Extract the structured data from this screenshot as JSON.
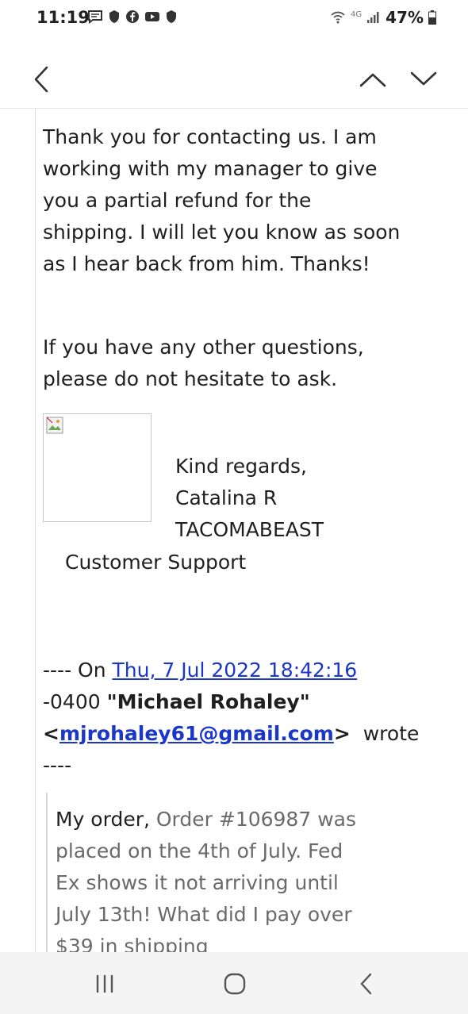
{
  "status_bar": {
    "time": "11:19",
    "network": "4G",
    "battery": "47%"
  },
  "toolbar": {
    "back_icon": "chevron-left-icon",
    "prev_icon": "chevron-up-icon",
    "next_icon": "chevron-down-icon"
  },
  "email": {
    "paragraph1": "Thank you for contacting us. I am working with my manager to give you a partial refund for the shipping. I will let you know as soon as I hear back from him. Thanks!",
    "paragraph2": "If you have any other questions, please do not hesitate to ask.",
    "signature": {
      "line1": "Kind regards,",
      "line2": "Catalina R",
      "line3": "TACOMABEAST",
      "line4": "Customer Support"
    },
    "quote_header": {
      "prefix": "---- On",
      "date_link": "Thu, 7 Jul 2022 18:42:16",
      "tz": "-0400",
      "sender_name": "\"Michael Rohaley\"",
      "lt": "<",
      "sender_email": "mjrohaley61@gmail.com",
      "gt": ">",
      "wrote": "wrote",
      "suffix": "----"
    },
    "quoted": {
      "lead": "My order,",
      "text": "Order #106987 was placed on the 4th of July.  Fed Ex shows it not arriving until July 13th!  What did I pay over $39 in shipping"
    }
  },
  "colors": {
    "link": "#1a37c9",
    "quoted_text": "#6a6a6a",
    "nav_bg": "#f4f4f4"
  }
}
